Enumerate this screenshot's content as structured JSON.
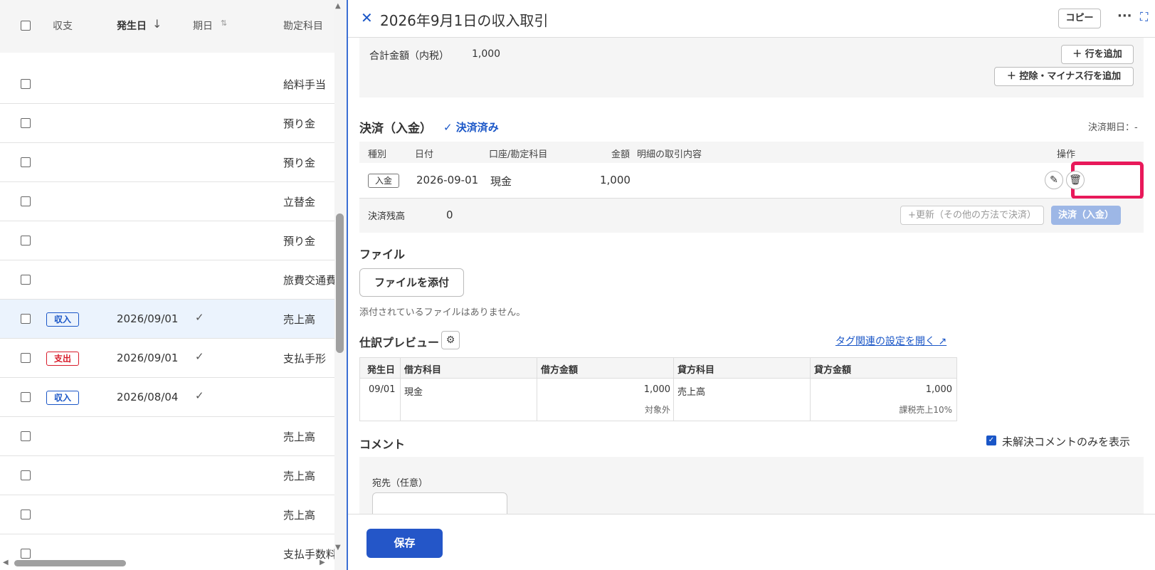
{
  "table": {
    "headers": {
      "kind": "収支",
      "date": "発生日",
      "due": "期日",
      "account": "勘定科目"
    },
    "rows": [
      {
        "kind": "",
        "date": "",
        "check": "",
        "account": "給料手当"
      },
      {
        "kind": "",
        "date": "",
        "check": "",
        "account": "預り金"
      },
      {
        "kind": "",
        "date": "",
        "check": "",
        "account": "預り金"
      },
      {
        "kind": "",
        "date": "",
        "check": "",
        "account": "立替金"
      },
      {
        "kind": "",
        "date": "",
        "check": "",
        "account": "預り金"
      },
      {
        "kind": "",
        "date": "",
        "check": "",
        "account": "旅費交通費"
      },
      {
        "kind": "収入",
        "date": "2026/09/01",
        "check": "✓",
        "account": "売上高"
      },
      {
        "kind": "支出",
        "date": "2026/09/01",
        "check": "✓",
        "account": "支払手形"
      },
      {
        "kind": "収入",
        "date": "2026/08/04",
        "check": "✓",
        "account": ""
      },
      {
        "kind": "",
        "date": "",
        "check": "",
        "account": "売上高"
      },
      {
        "kind": "",
        "date": "",
        "check": "",
        "account": "売上高"
      },
      {
        "kind": "",
        "date": "",
        "check": "",
        "account": "売上高"
      },
      {
        "kind": "",
        "date": "",
        "check": "",
        "account": "支払手数料"
      }
    ]
  },
  "panel": {
    "title": "2026年9月1日の収入取引",
    "copy": "コピー",
    "more": "···",
    "total_label": "合計金額（内税）",
    "total_value": "1,000",
    "add_row": "行を追加",
    "add_minus_row": "控除・マイナス行を追加",
    "settlement": {
      "title": "決済（入金）",
      "status": "決済済み",
      "due": "決済期日：-",
      "headers": {
        "kind": "種別",
        "date": "日付",
        "account": "口座/勘定科目",
        "amount": "金額",
        "desc": "明細の取引内容",
        "ops": "操作"
      },
      "row": {
        "kind": "入金",
        "date": "2026-09-01",
        "account": "現金",
        "amount": "1,000",
        "desc": ""
      },
      "balance_label": "決済残高",
      "balance_value": "0",
      "update_other": "+更新（その他の方法で決済）",
      "pay_button": "決済（入金）"
    },
    "file": {
      "title": "ファイル",
      "attach": "ファイルを添付",
      "none": "添付されているファイルはありません。"
    },
    "journal": {
      "title": "仕訳プレビュー",
      "tag_link": "タグ関連の設定を開く",
      "headers": {
        "date": "発生日",
        "debit_account": "借方科目",
        "debit_amount": "借方金額",
        "credit_account": "貸方科目",
        "credit_amount": "貸方金額"
      },
      "row": {
        "date": "09/01",
        "debit_account": "現金",
        "debit_amount": "1,000",
        "debit_tax": "対象外",
        "credit_account": "売上高",
        "credit_amount": "1,000",
        "credit_tax": "課税売上10%"
      }
    },
    "comment": {
      "title": "コメント",
      "unresolved_only": "未解決コメントのみを表示",
      "dest_label": "宛先（任意）"
    },
    "save": "保存"
  }
}
